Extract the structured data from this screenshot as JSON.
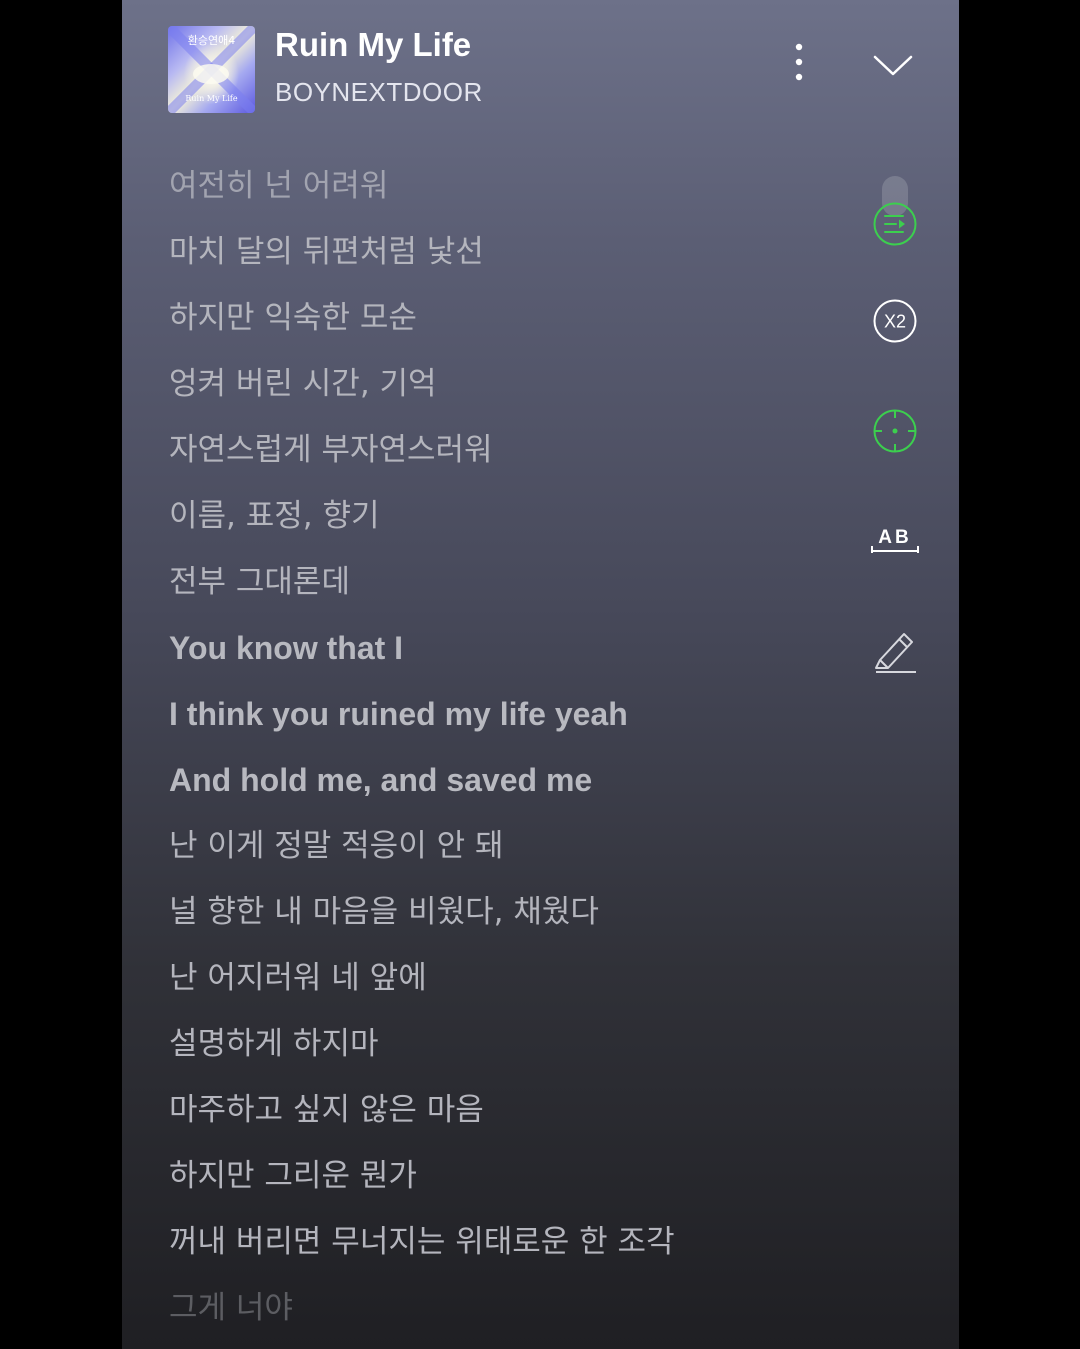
{
  "now_playing": {
    "title": "Ruin My Life",
    "artist": "BOYNEXTDOOR",
    "album_art": {
      "top_text": "환승연애4",
      "bottom_text": "Ruin My Life"
    }
  },
  "accent_color": "#3ccf4e",
  "lyrics": [
    "여전히 넌 어려워",
    "마치 달의 뒤편처럼 낯선",
    "하지만 익숙한 모순",
    "엉켜 버린 시간, 기억",
    "자연스럽게 부자연스러워",
    "이름, 표정, 향기",
    "전부 그대론데",
    "You know that I",
    "I think you ruined my life yeah",
    "And hold me, and saved me",
    "난 이게 정말 적응이 안 돼",
    "널 향한 내 마음을 비웠다, 채웠다",
    "난 어지러워 네 앞에",
    "설명하게 하지마",
    "마주하고 싶지 않은 마음",
    "하지만 그리운 뭔가",
    "꺼내 버리면 무너지는 위태로운 한 조각",
    "그게 너야"
  ],
  "side_controls": {
    "speed_label": "X2",
    "ab_label": "AB"
  },
  "icons": {
    "more": "more-vertical-icon",
    "collapse": "chevron-down-icon",
    "playlist": "playlist-play-icon",
    "speed": "speed-x2-icon",
    "focus": "crosshair-icon",
    "ab_repeat": "ab-repeat-icon",
    "highlight": "highlighter-icon"
  }
}
